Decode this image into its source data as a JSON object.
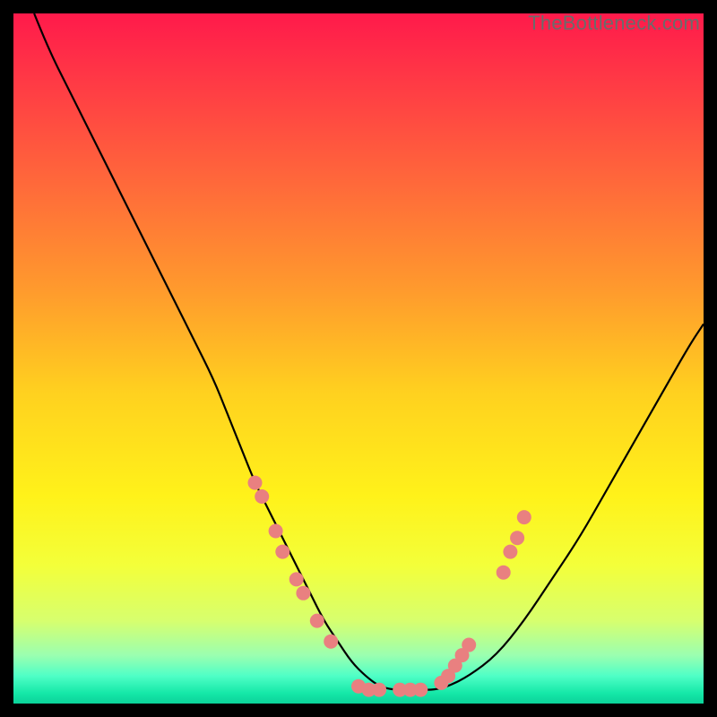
{
  "watermark": "TheBottleneck.com",
  "chart_data": {
    "type": "line",
    "title": "",
    "xlabel": "",
    "ylabel": "",
    "xlim": [
      0,
      100
    ],
    "ylim": [
      0,
      100
    ],
    "grid": false,
    "legend": false,
    "background_gradient_stops": [
      {
        "offset": 0.0,
        "color": "#ff1a4b"
      },
      {
        "offset": 0.1,
        "color": "#ff3a45"
      },
      {
        "offset": 0.25,
        "color": "#ff6a3a"
      },
      {
        "offset": 0.4,
        "color": "#ff9a2d"
      },
      {
        "offset": 0.55,
        "color": "#ffd11f"
      },
      {
        "offset": 0.7,
        "color": "#fff21a"
      },
      {
        "offset": 0.8,
        "color": "#f3ff3a"
      },
      {
        "offset": 0.88,
        "color": "#d7ff6e"
      },
      {
        "offset": 0.93,
        "color": "#9bffb0"
      },
      {
        "offset": 0.96,
        "color": "#4fffc6"
      },
      {
        "offset": 0.985,
        "color": "#15e8a8"
      },
      {
        "offset": 1.0,
        "color": "#0bd29a"
      }
    ],
    "series": [
      {
        "name": "bottleneck-curve",
        "stroke": "#000000",
        "x": [
          3,
          5,
          8,
          11,
          14,
          17,
          20,
          23,
          26,
          29,
          31,
          33,
          35,
          37,
          39,
          41,
          43,
          45,
          47,
          49,
          51,
          53,
          55,
          57,
          59,
          61,
          63,
          66,
          70,
          74,
          78,
          82,
          86,
          90,
          94,
          98,
          100
        ],
        "y": [
          100,
          95,
          89,
          83,
          77,
          71,
          65,
          59,
          53,
          47,
          42,
          37,
          32,
          28,
          24,
          20,
          16,
          12,
          9,
          6,
          4,
          2.5,
          2,
          2,
          2,
          2,
          2.5,
          4,
          7,
          12,
          18,
          24,
          31,
          38,
          45,
          52,
          55
        ]
      }
    ],
    "markers": {
      "name": "highlighted-points",
      "color": "#e98080",
      "radius_px": 8,
      "points": [
        {
          "x": 35,
          "y": 32
        },
        {
          "x": 36,
          "y": 30
        },
        {
          "x": 38,
          "y": 25
        },
        {
          "x": 39,
          "y": 22
        },
        {
          "x": 41,
          "y": 18
        },
        {
          "x": 42,
          "y": 16
        },
        {
          "x": 44,
          "y": 12
        },
        {
          "x": 46,
          "y": 9
        },
        {
          "x": 50,
          "y": 2.5
        },
        {
          "x": 51.5,
          "y": 2
        },
        {
          "x": 53,
          "y": 2
        },
        {
          "x": 56,
          "y": 2
        },
        {
          "x": 57.5,
          "y": 2
        },
        {
          "x": 59,
          "y": 2
        },
        {
          "x": 62,
          "y": 3
        },
        {
          "x": 63,
          "y": 4
        },
        {
          "x": 64,
          "y": 5.5
        },
        {
          "x": 65,
          "y": 7
        },
        {
          "x": 66,
          "y": 8.5
        },
        {
          "x": 71,
          "y": 19
        },
        {
          "x": 72,
          "y": 22
        },
        {
          "x": 73,
          "y": 24
        },
        {
          "x": 74,
          "y": 27
        }
      ]
    }
  }
}
